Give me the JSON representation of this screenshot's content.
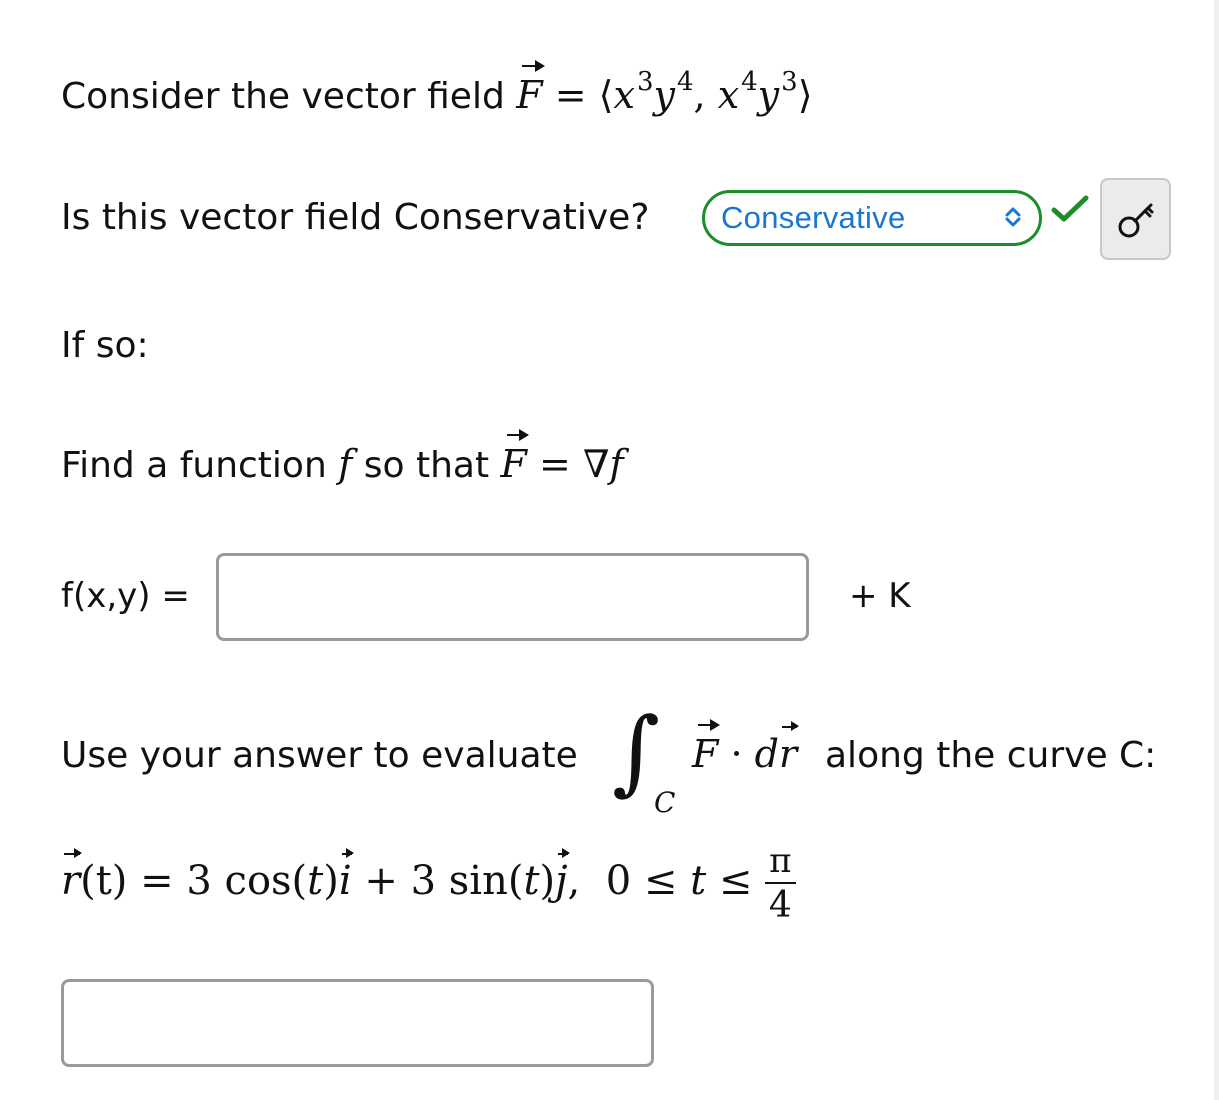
{
  "question": {
    "intro_text": "Consider the vector field",
    "field": {
      "symbol": "F",
      "eq": "=",
      "open": "⟨",
      "c1_base1": "x",
      "c1_exp1": "3",
      "c1_base2": "y",
      "c1_exp2": "4",
      "comma": ",",
      "c2_base1": "x",
      "c2_exp1": "4",
      "c2_base2": "y",
      "c2_exp2": "3",
      "close": "⟩"
    },
    "conservative_prompt": "Is this vector field Conservative?",
    "dropdown": {
      "selected": "Conservative",
      "status": "correct"
    },
    "if_so": "If so:",
    "find_text_1": "Find a function",
    "find_f": "f",
    "find_text_2": "so that",
    "find_eq": "=",
    "find_nabla": "∇",
    "fxy_label": "f(x,y)",
    "fxy_eq": "=",
    "fxy_value": "",
    "plus_k": "+ K",
    "evaluate_text": "Use your answer to evaluate",
    "integral_sign": "∫",
    "integral_sub": "C",
    "integrand_dot": "·",
    "integrand_d": "d",
    "integrand_r": "r",
    "along_text": "along the curve C:",
    "curve": {
      "r": "r",
      "t_arg": "(t)",
      "eq": "=",
      "term1": "3 cos(",
      "t1": "t",
      "term1_close": ")",
      "i": "i",
      "plus": "+",
      "term2": "3 sin(",
      "t2": "t",
      "term2_close": ")",
      "j": "j",
      "comma": ",",
      "range_start": "0",
      "le1": "≤",
      "t3": "t",
      "le2": "≤",
      "frac_num": "π",
      "frac_den": "4"
    },
    "answer_value": ""
  },
  "colors": {
    "correct": "#1d8c2a",
    "dropdown_text": "#1877d2",
    "input_border": "#9a9a9a"
  }
}
